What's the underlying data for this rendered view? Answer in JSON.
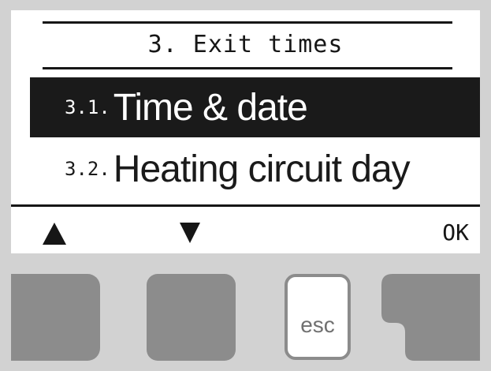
{
  "header": {
    "title": "3. Exit times"
  },
  "menu": {
    "items": [
      {
        "number": "3.1.",
        "label": "Time & date",
        "selected": true
      },
      {
        "number": "3.2.",
        "label": "Heating circuit day",
        "selected": false
      }
    ]
  },
  "softkeys": {
    "up_icon": "up-arrow-icon",
    "down_icon": "down-arrow-icon",
    "ok_label": "OK"
  },
  "hardware_buttons": {
    "esc_label": "esc"
  },
  "colors": {
    "bezel": "#d2d2d2",
    "screen_bg": "#ffffff",
    "ink": "#161616",
    "button_gray": "#8c8c8c"
  }
}
